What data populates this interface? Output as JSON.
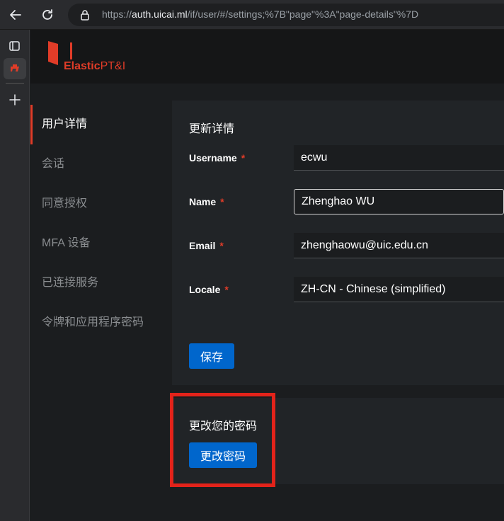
{
  "browser": {
    "url_prefix": "https://",
    "url_host": "auth.uicai.ml",
    "url_path": "/if/user/#/settings;%7B\"page\"%3A\"page-details\"%7D"
  },
  "brand": {
    "name_bold": "Elastic",
    "name_rest": "PT&I",
    "color": "#e03c28"
  },
  "nav": {
    "items": [
      {
        "label": "用户详情",
        "active": true
      },
      {
        "label": "会话"
      },
      {
        "label": "同意授权"
      },
      {
        "label": "MFA 设备"
      },
      {
        "label": "已连接服务"
      },
      {
        "label": "令牌和应用程序密码"
      }
    ]
  },
  "details_card": {
    "title": "更新详情",
    "fields": {
      "username": {
        "label": "Username",
        "required": "*",
        "value": "ecwu"
      },
      "name": {
        "label": "Name",
        "required": "*",
        "value": "Zhenghao WU"
      },
      "email": {
        "label": "Email",
        "required": "*",
        "value": "zhenghaowu@uic.edu.cn"
      },
      "locale": {
        "label": "Locale",
        "required": "*",
        "value": "ZH-CN - Chinese (simplified)"
      }
    },
    "save_label": "保存"
  },
  "password_card": {
    "title": "更改您的密码",
    "button_label": "更改密码"
  }
}
